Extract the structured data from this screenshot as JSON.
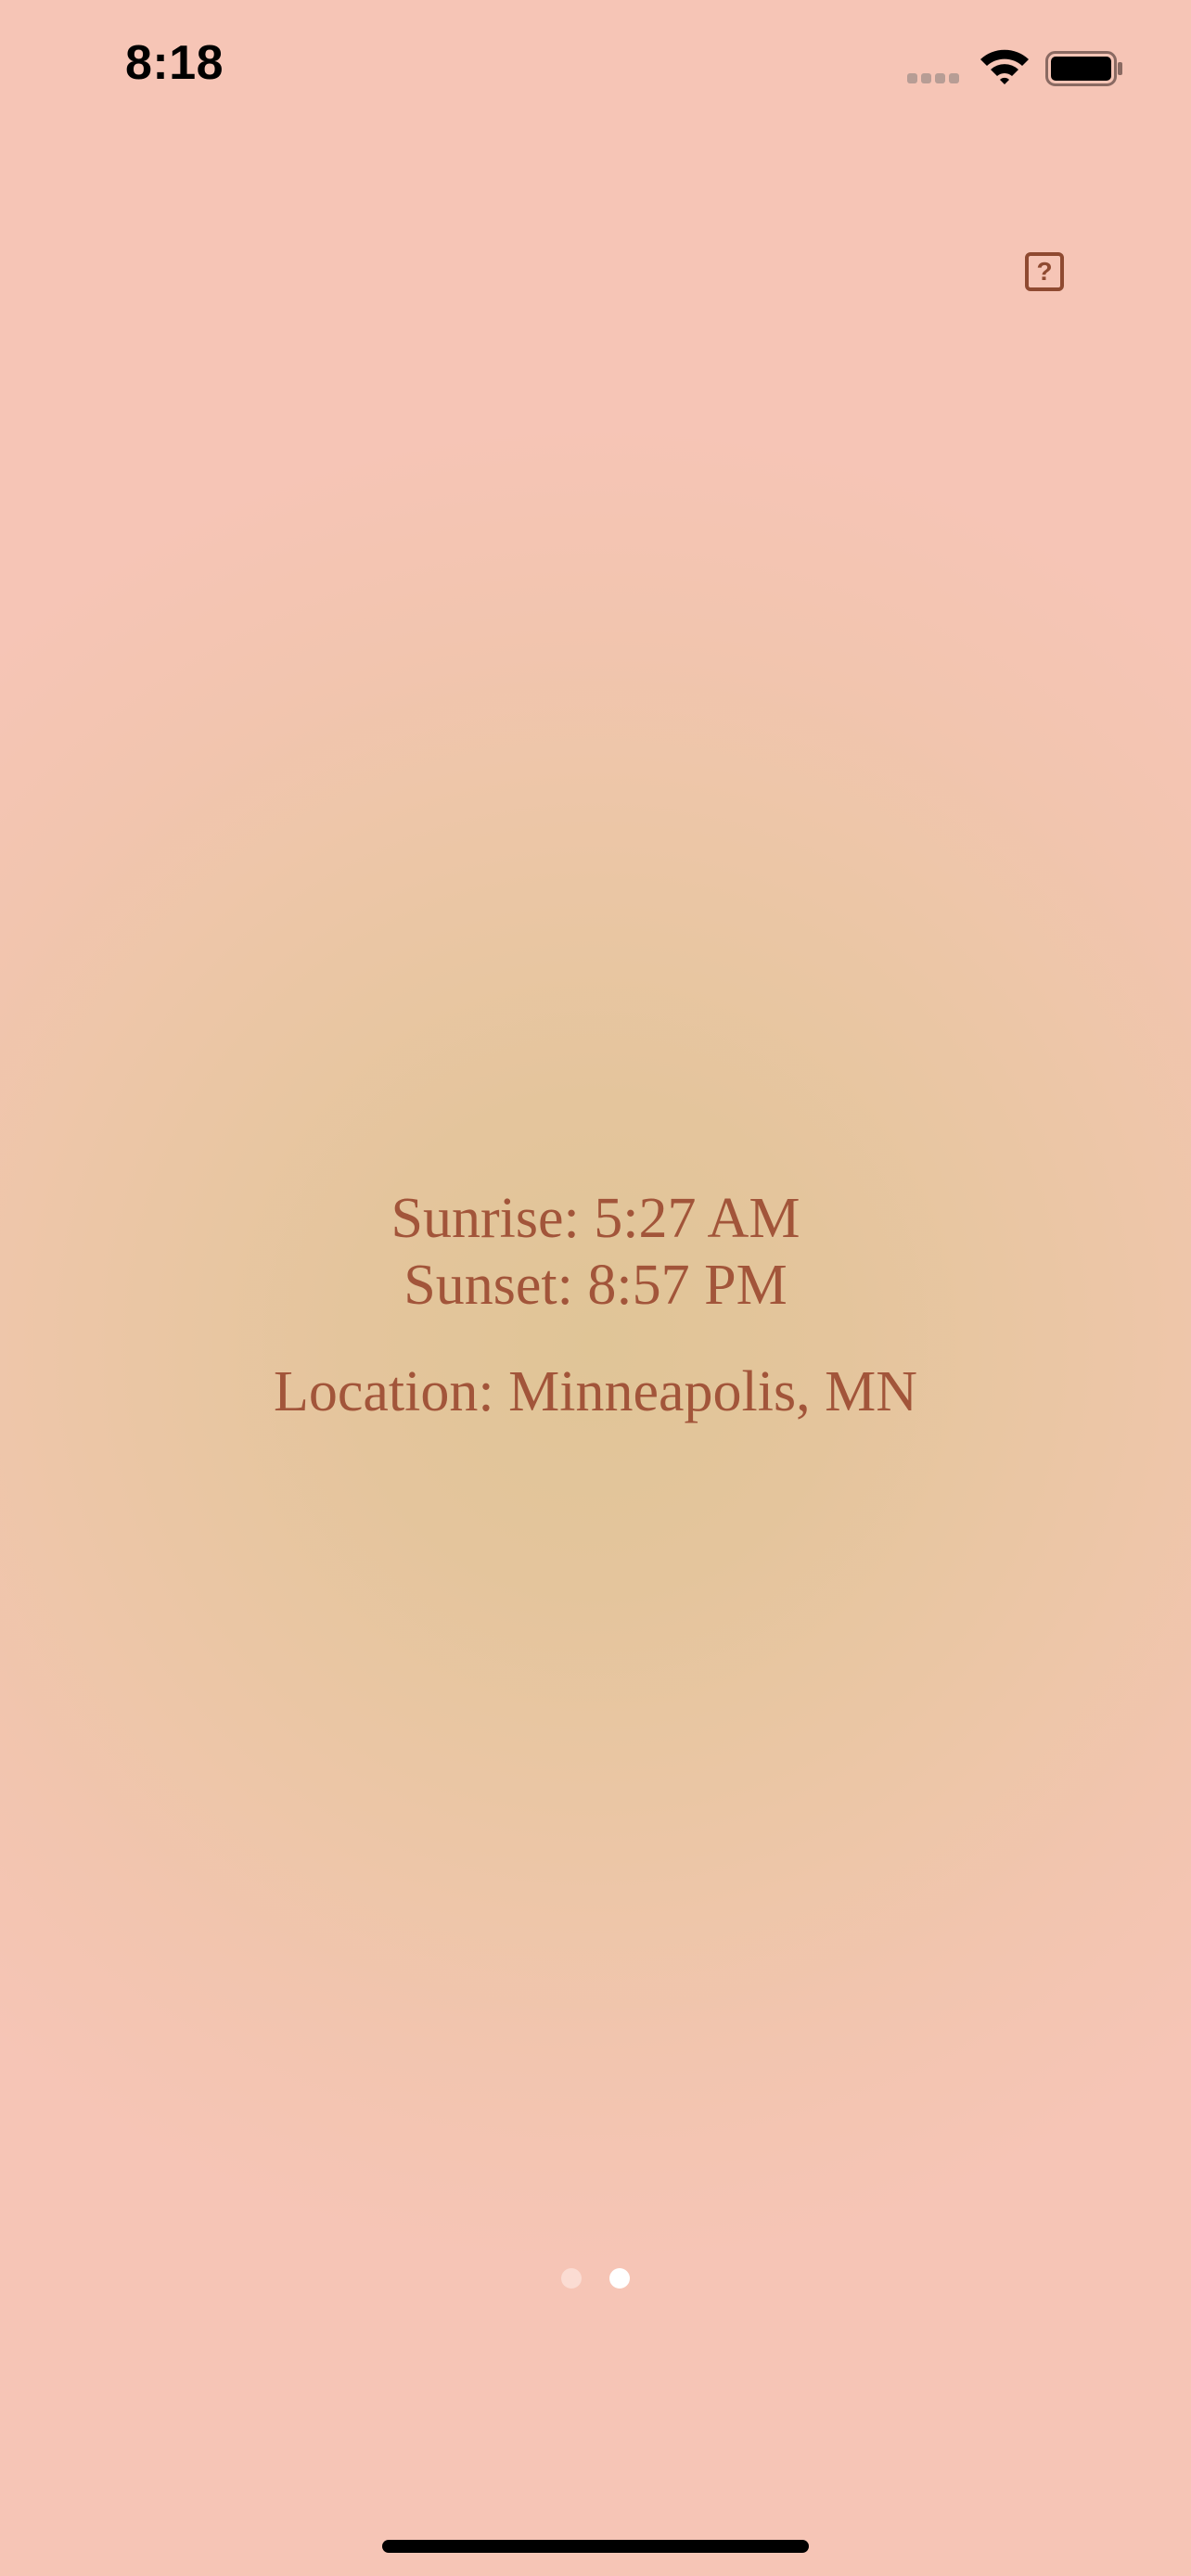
{
  "status_bar": {
    "time": "8:18",
    "icons": [
      "cellular-signal-icon",
      "wifi-icon",
      "battery-icon"
    ]
  },
  "header": {
    "help_icon": "question-mark-icon",
    "help_glyph": "?"
  },
  "sun_info": {
    "sunrise": "Sunrise: 5:27 AM",
    "sunset": "Sunset: 8:57 PM",
    "location": "Location: Minneapolis, MN"
  },
  "page_indicator": {
    "total": 2,
    "current": 2
  },
  "colors": {
    "background": "#f6c5b6",
    "center_glow": "#e0c597",
    "text_accent": "#a2553a",
    "dot_active": "#ffffff",
    "dot_inactive": "#fbdcd3"
  }
}
